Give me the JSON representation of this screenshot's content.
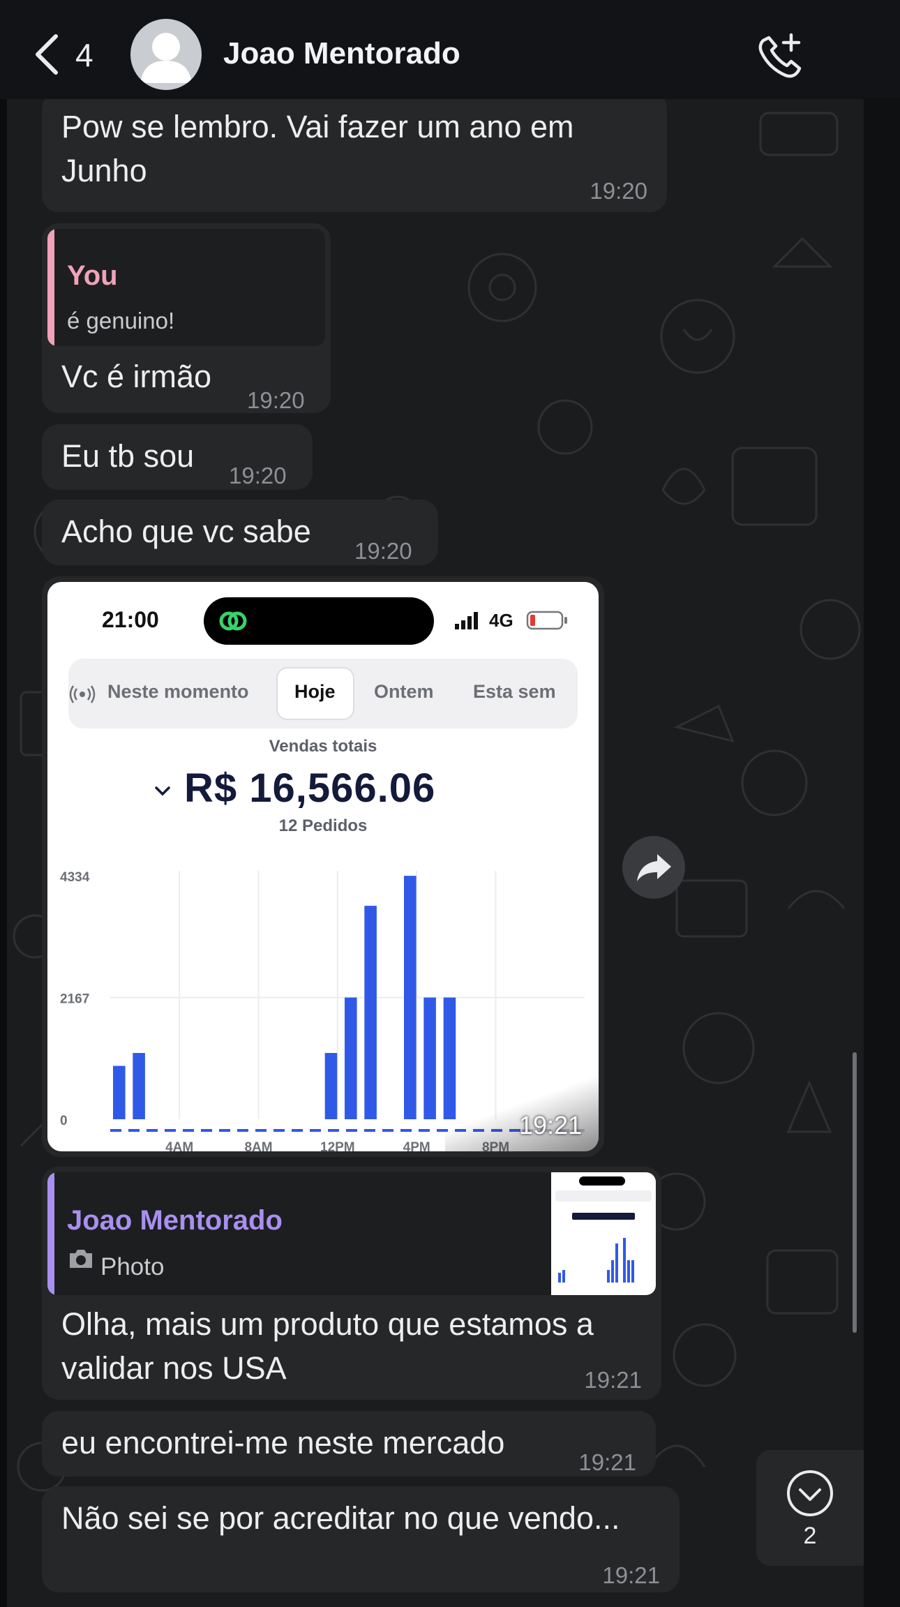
{
  "header": {
    "back_count": "4",
    "contact_name": "Joao Mentorado",
    "icons": [
      "chevron-left-icon",
      "avatar-icon",
      "call-add-icon"
    ]
  },
  "messages": {
    "m1": {
      "text": "Pow se lembro. Vai fazer um ano em\nJunho",
      "time": "19:20"
    },
    "m2": {
      "quote_author": "You",
      "quote_text": "é genuino!",
      "text": "Vc é irmão",
      "time": "19:20"
    },
    "m3": {
      "text": "Eu tb sou",
      "time": "19:20"
    },
    "m4": {
      "text": "Acho que vc sabe",
      "time": "19:20"
    },
    "photo": {
      "time": "19:21",
      "status_time": "21:00",
      "network": "4G",
      "tabs": [
        "Neste momento",
        "Hoje",
        "Ontem",
        "Esta sem"
      ],
      "active_tab": "Hoje",
      "title": "Vendas totais",
      "total": "R$ 16,566.06",
      "orders": "12 Pedidos"
    },
    "m5": {
      "quote_author": "Joao Mentorado",
      "quote_text": "Photo",
      "text": "Olha, mais um produto que estamos a\nvalidar nos USA",
      "time": "19:21"
    },
    "m6": {
      "text": "eu encontrei-me neste mercado",
      "time": "19:21"
    },
    "m7": {
      "text": "Não sei se por acreditar no que vendo...",
      "time": "19:21"
    }
  },
  "scroll_down": {
    "unread": "2"
  },
  "colors": {
    "you_quote": "#f0a3b8",
    "contact_quote": "#a98ff0",
    "bar_blue": "#3059e8"
  },
  "chart_data": {
    "type": "bar",
    "ylim": [
      0,
      4334
    ],
    "yticks": [
      "4334",
      "2167",
      "0"
    ],
    "xticks": [
      "4AM",
      "8AM",
      "12PM",
      "4PM",
      "8PM"
    ],
    "x_hours": [
      0,
      1,
      11,
      12,
      13,
      15,
      16,
      17
    ],
    "values": [
      950,
      1180,
      1180,
      2167,
      3800,
      4334,
      2167,
      2167
    ]
  }
}
